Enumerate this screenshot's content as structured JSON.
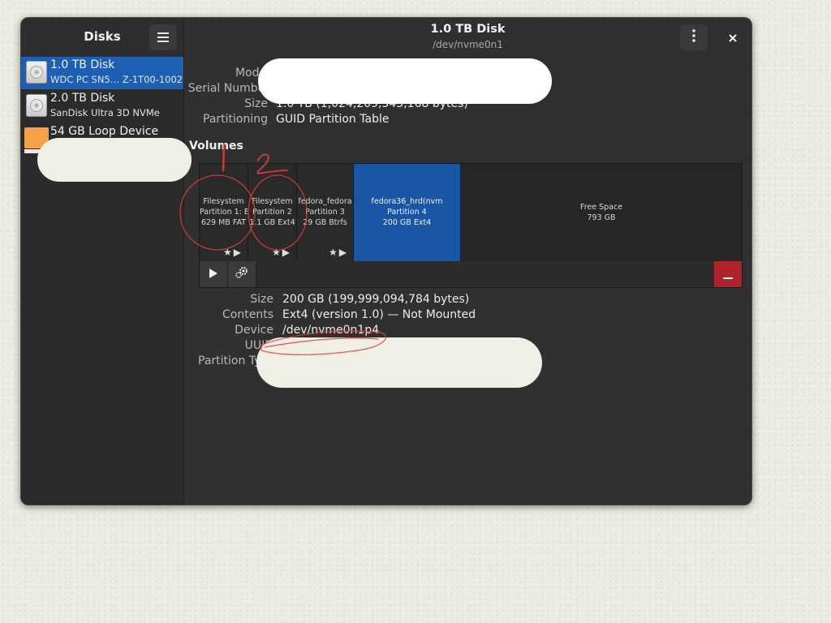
{
  "window": {
    "title": "1.0 TB Disk",
    "subtitle": "/dev/nvme0n1"
  },
  "sidebar": {
    "title": "Disks",
    "menu_icon": "hamburger-menu-icon",
    "items": [
      {
        "name": "1.0 TB Disk",
        "sub": "WDC PC SN5… Z-1T00-1002",
        "icon": "harddisk-icon",
        "selected": true
      },
      {
        "name": "2.0 TB Disk",
        "sub": "SanDisk Ultra 3D NVMe",
        "icon": "harddisk-icon",
        "selected": false
      },
      {
        "name": "54 GB Loop Device",
        "sub": "",
        "icon": "loop-device-icon",
        "selected": false
      }
    ]
  },
  "headerbar": {
    "more_icon": "vertical-ellipsis-icon",
    "close_icon": "close-icon"
  },
  "disk_info": {
    "model_label": "Model",
    "serial_label": "Serial Number",
    "size_label": "Size",
    "size_value": "1.0 TB (1,024,209,543,168 bytes)",
    "partitioning_label": "Partitioning",
    "partitioning_value": "GUID Partition Table"
  },
  "volumes": {
    "title": "Volumes",
    "partitions": [
      {
        "line1": "Filesystem",
        "line2": "Partition 1: E…",
        "line3": "629 MB FAT",
        "icons": "★▶",
        "selected": false
      },
      {
        "line1": "Filesystem",
        "line2": "Partition 2",
        "line3": "1.1 GB Ext4",
        "icons": "★▶",
        "selected": false
      },
      {
        "line1": "fedora_fedora",
        "line2": "Partition 3",
        "line3": "29 GB Btrfs",
        "icons": "★▶",
        "selected": false
      },
      {
        "line1": "fedora36_hrd(nvm",
        "line2": "Partition 4",
        "line3": "200 GB Ext4",
        "icons": "",
        "selected": true
      },
      {
        "line1": "Free Space",
        "line2": "793 GB",
        "line3": "",
        "icons": "",
        "selected": false
      }
    ],
    "toolbar": {
      "mount_icon": "play-icon",
      "settings_icon": "gears-icon",
      "delete_icon": "minus-icon"
    }
  },
  "volume_info": {
    "size_label": "Size",
    "size_value": "200 GB (199,999,094,784 bytes)",
    "contents_label": "Contents",
    "contents_value": "Ext4 (version 1.0) — Not Mounted",
    "device_label": "Device",
    "device_value": "/dev/nvme0n1p4",
    "uuid_label": "UUID",
    "partition_type_label": "Partition Type"
  },
  "colors": {
    "accent": "#1c5fb3",
    "delete": "#b0232b",
    "annotation": "#e0403a"
  }
}
